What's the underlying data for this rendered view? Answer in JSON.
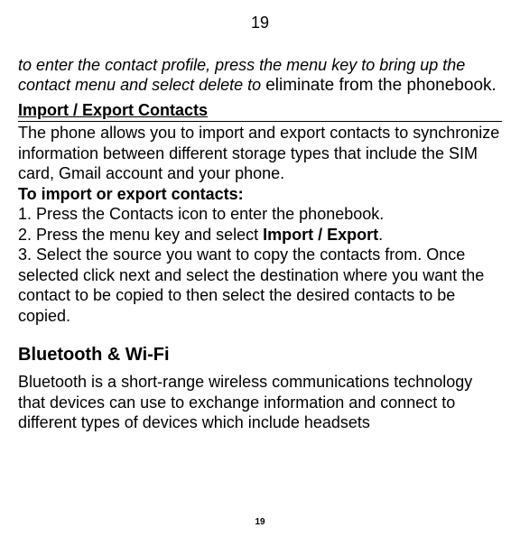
{
  "page": {
    "top_number": "19",
    "bottom_number": "19"
  },
  "intro": {
    "italic": "to enter the contact profile, press the menu key to bring up the contact menu and select delete to ",
    "nonitalic": "eliminate from the phonebook."
  },
  "section1": {
    "heading": "Import / Export Contacts",
    "p1": "The phone allows you to import and export contacts to synchronize information between different storage types that include the SIM card, Gmail account and your phone.",
    "sub_heading": "To import or export contacts:",
    "step1": "1. Press the Contacts icon to enter the phonebook.",
    "step2_pre": "2. Press the menu key and select ",
    "step2_bold": "Import / Export",
    "step2_post": ".",
    "step3": "3. Select the source you want to copy the contacts from. Once selected click next and select the destination where you want the contact to be copied to then select the desired contacts to be copied."
  },
  "section2": {
    "heading": "Bluetooth & Wi-Fi",
    "p1": "Bluetooth is a short-range wireless communications technology that devices can use to exchange information and connect to different types of devices which include headsets"
  }
}
